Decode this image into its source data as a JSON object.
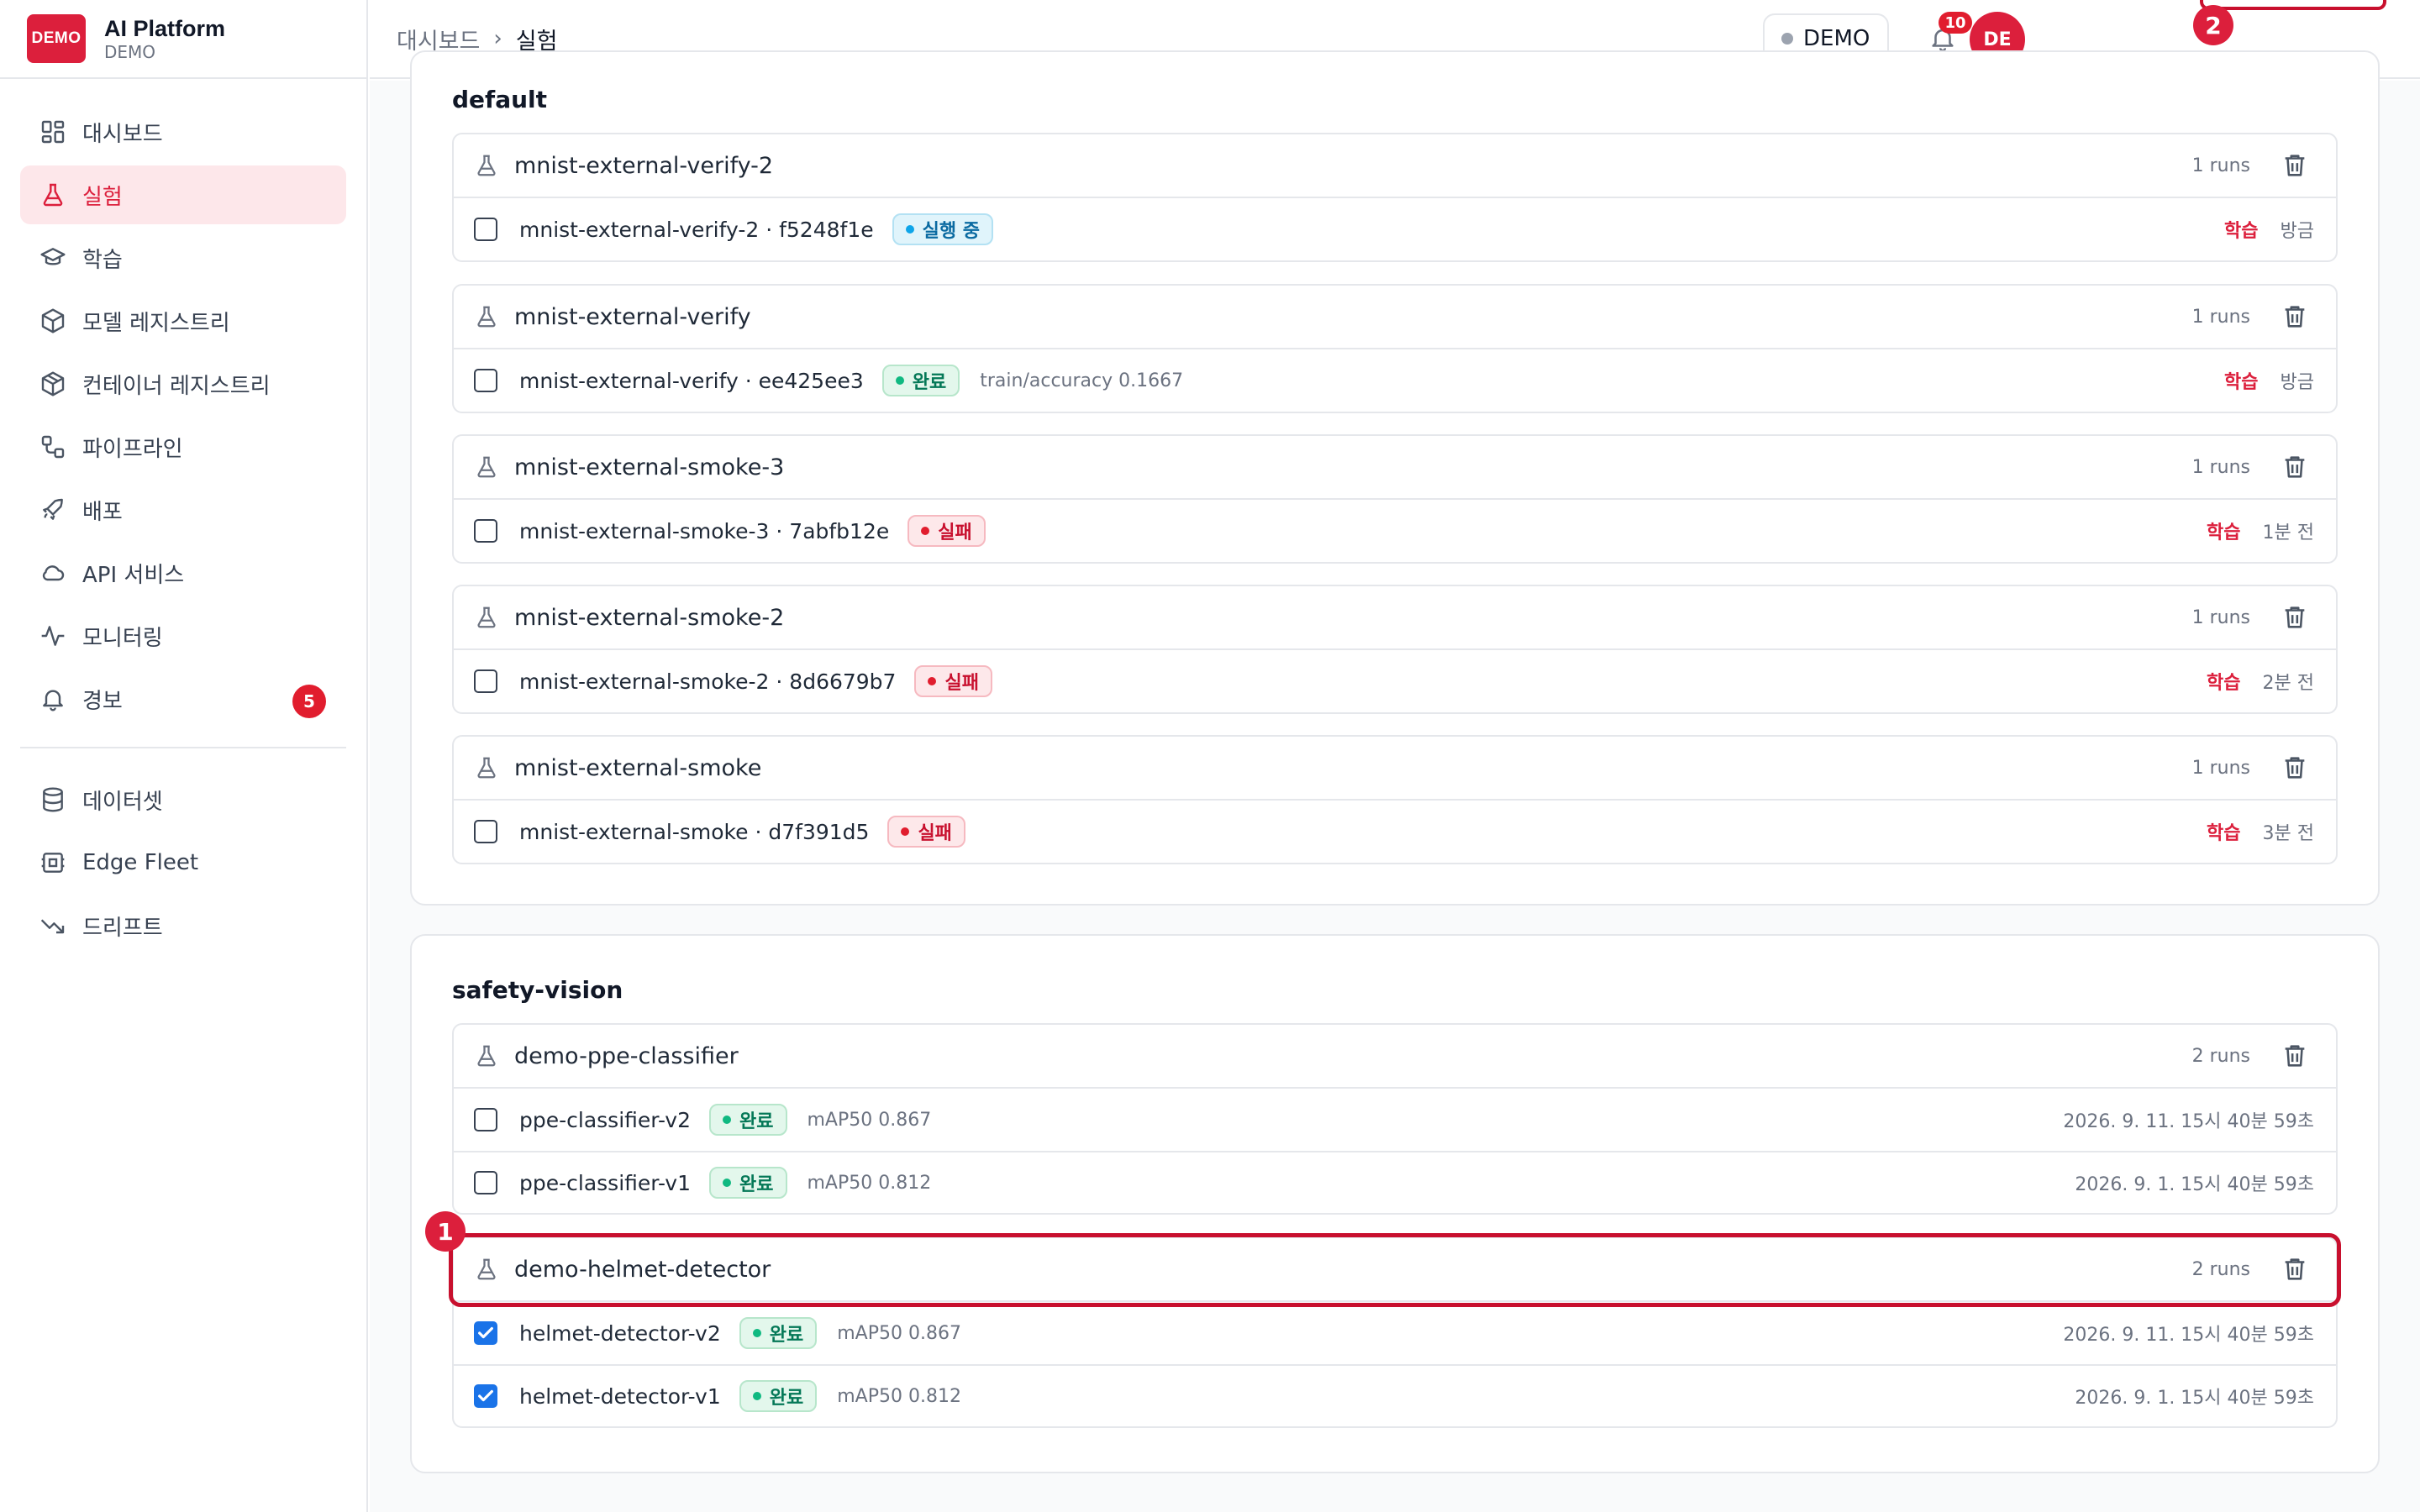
{
  "brand": {
    "logo": "DEMO",
    "title": "AI Platform",
    "subtitle": "DEMO"
  },
  "nav": [
    {
      "label": "대시보드",
      "icon": "dashboard-icon",
      "active": false
    },
    {
      "label": "실험",
      "icon": "flask-icon",
      "active": true
    },
    {
      "label": "학습",
      "icon": "graduation-cap-icon",
      "active": false
    },
    {
      "label": "모델 레지스트리",
      "icon": "cube-icon",
      "active": false
    },
    {
      "label": "컨테이너 레지스트리",
      "icon": "container-icon",
      "active": false
    },
    {
      "label": "파이프라인",
      "icon": "pipeline-icon",
      "active": false
    },
    {
      "label": "배포",
      "icon": "rocket-icon",
      "active": false
    },
    {
      "label": "API 서비스",
      "icon": "cloud-icon",
      "active": false
    },
    {
      "label": "모니터링",
      "icon": "activity-icon",
      "active": false
    },
    {
      "label": "경보",
      "icon": "bell-icon",
      "active": false,
      "badge": "5"
    }
  ],
  "nav_secondary": [
    {
      "label": "데이터셋",
      "icon": "database-icon"
    },
    {
      "label": "Edge Fleet",
      "icon": "edge-device-icon"
    },
    {
      "label": "드리프트",
      "icon": "trend-down-icon"
    }
  ],
  "breadcrumb": {
    "parent": "대시보드",
    "separator": "›",
    "current": "실험"
  },
  "topbar": {
    "env_label": "DEMO",
    "notification_count": "10",
    "avatar_initials": "DE"
  },
  "markers": {
    "first": "1",
    "second": "2"
  },
  "projects": [
    {
      "title": "default",
      "experiments": [
        {
          "name": "mnist-external-verify-2",
          "runs_label": "1 runs",
          "runs": [
            {
              "name": "mnist-external-verify-2 · f5248f1e",
              "status": "실행 중",
              "status_kind": "running",
              "metric": "",
              "type": "학습",
              "time": "방금",
              "checked": false
            }
          ]
        },
        {
          "name": "mnist-external-verify",
          "runs_label": "1 runs",
          "runs": [
            {
              "name": "mnist-external-verify · ee425ee3",
              "status": "완료",
              "status_kind": "done",
              "metric": "train/accuracy 0.1667",
              "type": "학습",
              "time": "방금",
              "checked": false
            }
          ]
        },
        {
          "name": "mnist-external-smoke-3",
          "runs_label": "1 runs",
          "runs": [
            {
              "name": "mnist-external-smoke-3 · 7abfb12e",
              "status": "실패",
              "status_kind": "fail",
              "metric": "",
              "type": "학습",
              "time": "1분 전",
              "checked": false
            }
          ]
        },
        {
          "name": "mnist-external-smoke-2",
          "runs_label": "1 runs",
          "runs": [
            {
              "name": "mnist-external-smoke-2 · 8d6679b7",
              "status": "실패",
              "status_kind": "fail",
              "metric": "",
              "type": "학습",
              "time": "2분 전",
              "checked": false
            }
          ]
        },
        {
          "name": "mnist-external-smoke",
          "runs_label": "1 runs",
          "runs": [
            {
              "name": "mnist-external-smoke · d7f391d5",
              "status": "실패",
              "status_kind": "fail",
              "metric": "",
              "type": "학습",
              "time": "3분 전",
              "checked": false
            }
          ]
        }
      ]
    },
    {
      "title": "safety-vision",
      "experiments": [
        {
          "name": "demo-ppe-classifier",
          "runs_label": "2 runs",
          "runs": [
            {
              "name": "ppe-classifier-v2",
              "status": "완료",
              "status_kind": "done",
              "metric": "mAP50 0.867",
              "type": "",
              "time": "2026. 9. 11. 15시 40분 59초",
              "checked": false
            },
            {
              "name": "ppe-classifier-v1",
              "status": "완료",
              "status_kind": "done",
              "metric": "mAP50 0.812",
              "type": "",
              "time": "2026. 9. 1. 15시 40분 59초",
              "checked": false
            }
          ]
        },
        {
          "name": "demo-helmet-detector",
          "runs_label": "2 runs",
          "runs": [
            {
              "name": "helmet-detector-v2",
              "status": "완료",
              "status_kind": "done",
              "metric": "mAP50 0.867",
              "type": "",
              "time": "2026. 9. 11. 15시 40분 59초",
              "checked": true
            },
            {
              "name": "helmet-detector-v1",
              "status": "완료",
              "status_kind": "done",
              "metric": "mAP50 0.812",
              "type": "",
              "time": "2026. 9. 1. 15시 40분 59초",
              "checked": true
            }
          ]
        }
      ]
    }
  ]
}
